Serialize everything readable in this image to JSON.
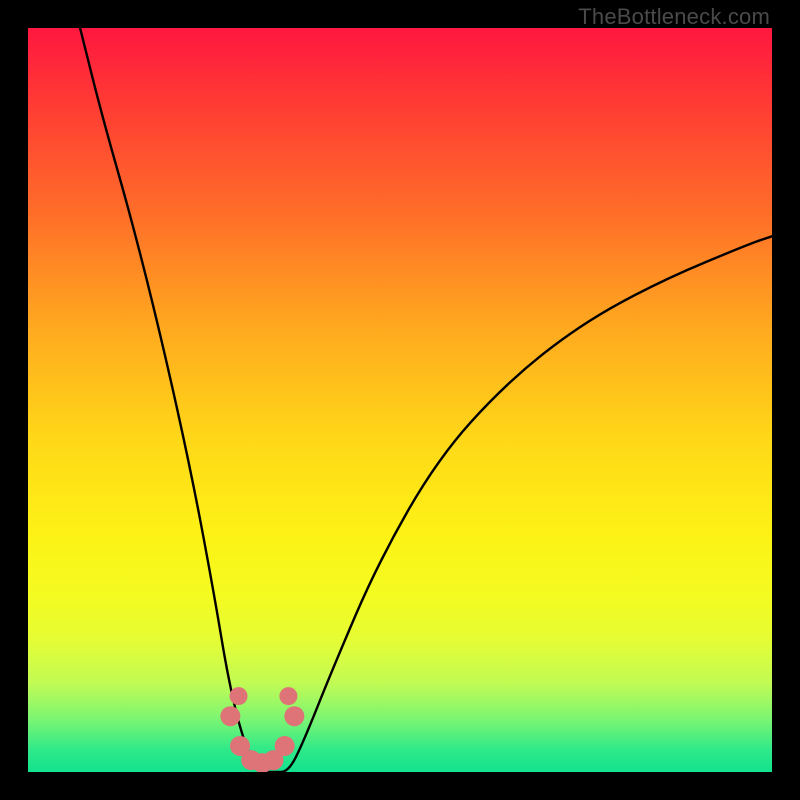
{
  "credit": "TheBottleneck.com",
  "chart_data": {
    "type": "line",
    "title": "",
    "xlabel": "",
    "ylabel": "",
    "xlim": [
      0,
      100
    ],
    "ylim": [
      0,
      100
    ],
    "series": [
      {
        "name": "bottleneck-curve",
        "x": [
          7,
          10,
          14,
          18,
          22,
          25,
          27,
          29,
          31,
          33,
          35,
          37,
          41,
          47,
          55,
          64,
          74,
          85,
          97,
          100
        ],
        "values": [
          100,
          88,
          74,
          58,
          40,
          24,
          12,
          4,
          0,
          0,
          0,
          4,
          14,
          28,
          42,
          52,
          60,
          66,
          71,
          72
        ]
      }
    ],
    "markers": {
      "color": "#DE7378",
      "points_x": [
        27.2,
        28.5,
        30,
        31.5,
        33,
        34.5,
        35.8,
        28.3,
        35.0
      ],
      "points_y": [
        7.5,
        3.5,
        1.6,
        1.2,
        1.6,
        3.5,
        7.5,
        10.2,
        10.2
      ]
    },
    "gradient_stops": [
      {
        "pos": 0.0,
        "color": "#FF173F"
      },
      {
        "pos": 0.1,
        "color": "#FF3A34"
      },
      {
        "pos": 0.25,
        "color": "#FF6E29"
      },
      {
        "pos": 0.4,
        "color": "#FFA81F"
      },
      {
        "pos": 0.55,
        "color": "#FFD718"
      },
      {
        "pos": 0.68,
        "color": "#FDF215"
      },
      {
        "pos": 0.76,
        "color": "#F4FB20"
      },
      {
        "pos": 0.82,
        "color": "#E6FC33"
      },
      {
        "pos": 0.88,
        "color": "#C2FB53"
      },
      {
        "pos": 0.93,
        "color": "#7AF573"
      },
      {
        "pos": 0.97,
        "color": "#2FE989"
      },
      {
        "pos": 1.0,
        "color": "#13E28E"
      }
    ]
  }
}
